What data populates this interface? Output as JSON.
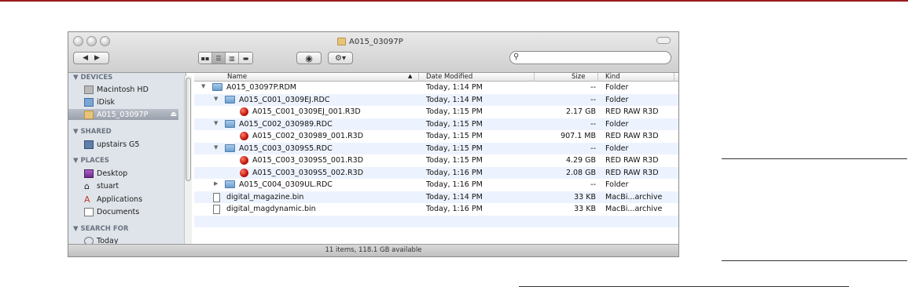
{
  "window": {
    "title": "A015_03097P",
    "status": "11 items, 118.1 GB available"
  },
  "sidebar": {
    "devices_header": "DEVICES",
    "devices": [
      "Macintosh HD",
      "iDisk",
      "A015_03097P"
    ],
    "shared_header": "SHARED",
    "shared": [
      "upstairs G5"
    ],
    "places_header": "PLACES",
    "places": [
      "Desktop",
      "stuart",
      "Applications",
      "Documents"
    ],
    "search_header": "SEARCH FOR",
    "search": [
      "Today"
    ]
  },
  "columns": {
    "name": "Name",
    "date": "Date Modified",
    "size": "Size",
    "kind": "Kind"
  },
  "rows": [
    {
      "name": "A015_03097P.RDM",
      "date": "Today, 1:14 PM",
      "size": "--",
      "kind": "Folder"
    },
    {
      "name": "A015_C001_0309EJ.RDC",
      "date": "Today, 1:14 PM",
      "size": "--",
      "kind": "Folder"
    },
    {
      "name": "A015_C001_0309EJ_001.R3D",
      "date": "Today, 1:15 PM",
      "size": "2.17 GB",
      "kind": "RED RAW R3D"
    },
    {
      "name": "A015_C002_030989.RDC",
      "date": "Today, 1:15 PM",
      "size": "--",
      "kind": "Folder"
    },
    {
      "name": "A015_C002_030989_001.R3D",
      "date": "Today, 1:15 PM",
      "size": "907.1 MB",
      "kind": "RED RAW R3D"
    },
    {
      "name": "A015_C003_0309S5.RDC",
      "date": "Today, 1:15 PM",
      "size": "--",
      "kind": "Folder"
    },
    {
      "name": "A015_C003_0309S5_001.R3D",
      "date": "Today, 1:15 PM",
      "size": "4.29 GB",
      "kind": "RED RAW R3D"
    },
    {
      "name": "A015_C003_0309S5_002.R3D",
      "date": "Today, 1:16 PM",
      "size": "2.08 GB",
      "kind": "RED RAW R3D"
    },
    {
      "name": "A015_C004_0309UL.RDC",
      "date": "Today, 1:16 PM",
      "size": "--",
      "kind": "Folder"
    },
    {
      "name": "digital_magazine.bin",
      "date": "Today, 1:14 PM",
      "size": "33 KB",
      "kind": "MacBi...archive"
    },
    {
      "name": "digital_magdynamic.bin",
      "date": "Today, 1:16 PM",
      "size": "33 KB",
      "kind": "MacBi...archive"
    }
  ],
  "colors": {
    "accent_rule": "#9b1b1b",
    "row_alt": "#edf3fe",
    "selection": "#9aa1ac"
  }
}
